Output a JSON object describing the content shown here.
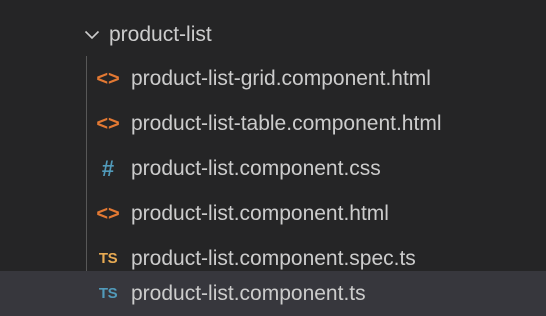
{
  "explorer": {
    "folder": {
      "name": "product-list",
      "expanded": true,
      "icon": "chevron-down-icon"
    },
    "files": [
      {
        "name": "product-list-grid.component.html",
        "icon": "html-file-icon",
        "glyph": "<>",
        "color": "#e37933"
      },
      {
        "name": "product-list-table.component.html",
        "icon": "html-file-icon",
        "glyph": "<>",
        "color": "#e37933"
      },
      {
        "name": "product-list.component.css",
        "icon": "css-file-icon",
        "glyph": "#",
        "color": "#519aba"
      },
      {
        "name": "product-list.component.html",
        "icon": "html-file-icon",
        "glyph": "<>",
        "color": "#e37933"
      },
      {
        "name": "product-list.component.spec.ts",
        "icon": "typescript-test-file-icon",
        "glyph": "TS",
        "color": "#e8ab53"
      },
      {
        "name": "product-list.component.ts",
        "icon": "typescript-file-icon",
        "glyph": "TS",
        "color": "#519aba",
        "selected": true
      }
    ]
  }
}
